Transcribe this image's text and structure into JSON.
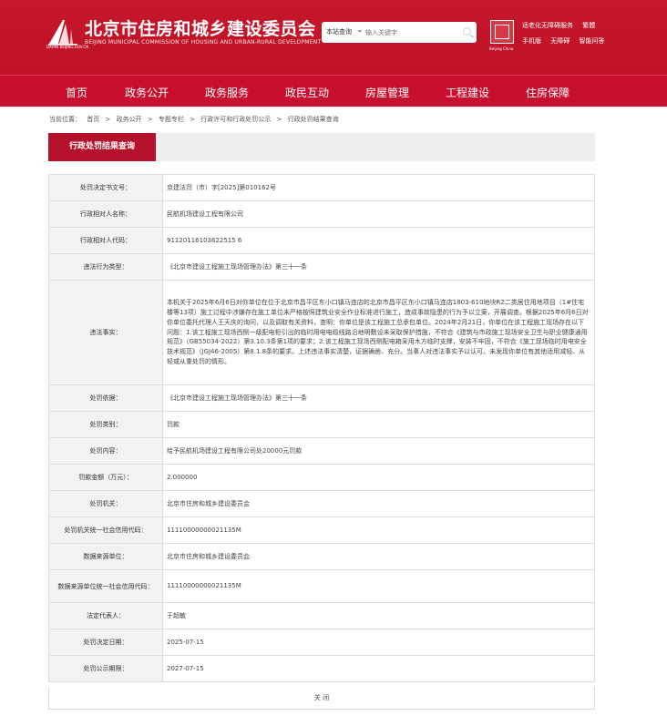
{
  "header": {
    "title": "北京市住房和城乡建设委员会",
    "subtitle": "BEIJING MUNICIPAL COMMISSION OF HOUSING AND URBAN-RURAL DEVELOPMENT",
    "logo_caption": "DAYAN BEIJING.GOV.CN",
    "search_scope": "本站查询",
    "search_placeholder": "输入关键字",
    "emblem_caption": "Beijing China",
    "links_row1": [
      "适老化无障碍服务",
      "繁體"
    ],
    "links_row2": [
      "手机版",
      "无障碍",
      "智能问答"
    ]
  },
  "nav": [
    "首页",
    "政务公开",
    "政务服务",
    "政民互动",
    "房屋管理",
    "工程建设",
    "住房保障"
  ],
  "breadcrumb": [
    "当前位置：",
    "首页",
    ">",
    "政务公开",
    ">",
    "专题专栏",
    ">",
    "行政许可和行政处罚公示",
    ">",
    "行政处罚结果查询"
  ],
  "tab_label": "行政处罚结果查询",
  "rows": [
    {
      "label": "处罚决定书文号：",
      "value": "京建法罚（市）字[2025]第010162号"
    },
    {
      "label": "行政相对人名称：",
      "value": "民航机场建设工程有限公司"
    },
    {
      "label": "行政相对人代码：",
      "value": "91120116103622515 6"
    },
    {
      "label": "违法行为类型：",
      "value": "《北京市建设工程施工现场管理办法》第三十一条"
    },
    {
      "label": "违法事实：",
      "value": "本机关于2025年6月6日对你单位在位于北京市昌平区东小口镇马连店的北京市昌平区东小口镇马连店1803-610地块R2二类居住用地项目（1#住宅楼等13项）施工过程中涉嫌存在施工单位未严格按照建筑业安全作业标准进行施工，造成事故隐患的行为予以立案，开展调查。根据2025年6月6日对你单位委托代理人王天庆的询问，以及调取有关资料，查明：你单位是该工程施工总承包单位。2024年2月21日，你单位在该工程施工现场存在以下问题：1.该工程施工现场西侧一级配电柜引出的临时用电电缆线路沿地明敷设未采取保护措施，不符合《建筑与市政施工现场安全卫生与职业健康通用规范》（GB55034-2022）第3.10.3条第1项的要求；2.该工程施工现场西侧配电箱采用木方临时支撑，安装不牢固，不符合《施工现场临时用电安全技术规范》（JGJ46-2005）第8.1.8条的要求。上述违法事实清楚，证据确凿、充分。当事人对违法事实予以认可。未发现你单位有其他适用减轻、从轻或从重处罚的情形。"
    },
    {
      "label": "处罚依据：",
      "value": "《北京市建设工程施工现场管理办法》第三十一条"
    },
    {
      "label": "处罚类别：",
      "value": "罚款"
    },
    {
      "label": "处罚内容：",
      "value": "给予民航机场建设工程有限公司处20000元罚款"
    },
    {
      "label": "罚款金额（万元）：",
      "value": "2.000000"
    },
    {
      "label": "处罚机关：",
      "value": "北京市住房和城乡建设委员会"
    },
    {
      "label": "处罚机关统一社会信用代码：",
      "value": "11110000000021135M"
    },
    {
      "label": "数据来源单位：",
      "value": "北京市住房和城乡建设委员会"
    },
    {
      "label": "数据来源单位统一社会信用代码：",
      "value": "11110000000021135M"
    },
    {
      "label": "法定代表人：",
      "value": "于超敏"
    },
    {
      "label": "处罚决定日期：",
      "value": "2025-07-15"
    },
    {
      "label": "处罚公示期限：",
      "value": "2027-07-15"
    }
  ],
  "close_label": "关 闭"
}
